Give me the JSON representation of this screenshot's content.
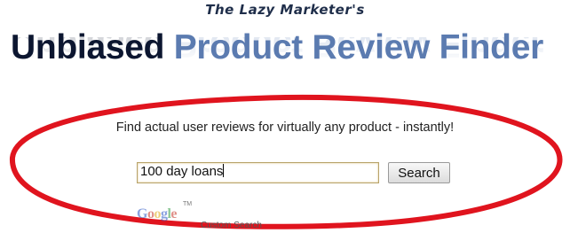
{
  "header": {
    "subtitle": "The Lazy Marketer's",
    "title_part1": "Unbiased",
    "title_part2": "Product Review Finder"
  },
  "main": {
    "tagline": "Find actual user reviews for virtually any product - instantly!",
    "search": {
      "value": "100 day loans",
      "button_label": "Search"
    }
  },
  "footer": {
    "logo_letters": [
      "G",
      "o",
      "o",
      "g",
      "l",
      "e"
    ],
    "trademark": "TM",
    "custom_search_label": "Custom Search"
  },
  "colors": {
    "annotation_ellipse": "#e0141e",
    "title_dark": "#0c1630",
    "title_blue": "#5b7bb0"
  }
}
